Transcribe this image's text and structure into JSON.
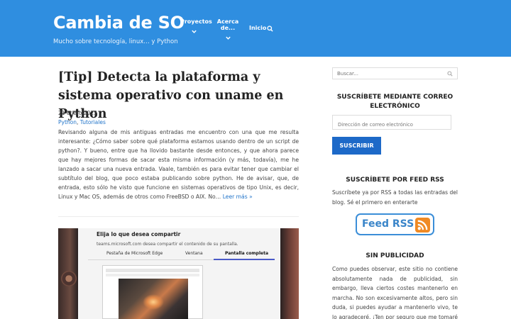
{
  "header": {
    "site_title": "Cambia de SO",
    "tagline": "Mucho sobre tecnología, linux… y Python",
    "nav": {
      "projects": "Proyectos",
      "about": "Acerca de...",
      "home": "Inicio"
    },
    "background": "#2f8ee0"
  },
  "post": {
    "title": "[Tip] Detecta la plataforma y sistema operativo con uname en Python",
    "date": "21 enero 2023",
    "categories": [
      "Python",
      "Tutoriales"
    ],
    "excerpt": "Revisando alguna de mis antiguas entradas me encuentro con una que me resulta interesante: ¿Cómo saber sobre qué plataforma estamos usando dentro de un script de python?. Y bueno, entre que ha llovido bastante desde entonces, y que ahora parece que hay mejores formas de sacar esta misma información (y más, todavía), me he lanzado a sacar una nueva entrada. Vaale, también es para evitar tener que cambiar el subtítulo del blog, que poco estaba publicando sobre python. He de avisar, que, de entrada, esto sólo he visto que funcione en sistemas operativos de tipo Unix, es decir, Linux y Mac OS, además de otros como FreeBSD o AIX. No…",
    "read_more": "Leer más »",
    "image": {
      "dialog_title": "Elija lo que desea compartir",
      "dialog_subtitle": "teams.microsoft.com desea compartir el contenido de su pantalla.",
      "tabs": [
        "Pestaña de Microsoft Edge",
        "Ventana",
        "Pantalla completa"
      ],
      "active_tab": "Pantalla completa"
    }
  },
  "sidebar": {
    "search_placeholder": "Buscar...",
    "subscribe_heading": "SUSCRÍBETE MEDIANTE CORREO ELECTRÓNICO",
    "email_placeholder": "Dirección de correo electrónico",
    "subscribe_button": "SUSCRIBIR",
    "rss_heading": "SUSCRÍBETE POR FEED RSS",
    "rss_text": "Suscríbete ya por RSS a todas las entradas del blog. Sé el primero en enterarte",
    "rss_badge": "Feed RSS",
    "ads_heading": "SIN PUBLICIDAD",
    "ads_text": "Como puedes observar, este sitio no contiene absolutamente nada de publicidad, sin embargo, lleva ciertos costes mantenerlo en marcha. No son excesivamente altos, pero sin duda, si puedes ayudar a mantenerlo vivo, te lo agradeceré. ¡Ten por seguro que me tomaré un"
  },
  "colors": {
    "accent": "#2f8ee0",
    "link": "#1f73c9",
    "button": "#1d69c8",
    "rss_orange": "#f08a24"
  }
}
